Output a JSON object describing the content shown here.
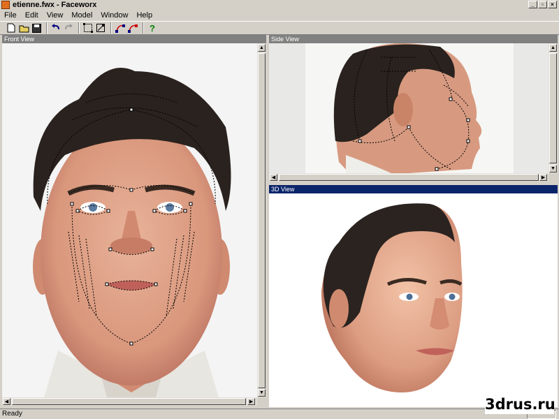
{
  "window": {
    "title": "etienne.fwx - Faceworx",
    "controls": [
      "_",
      "▫",
      "×"
    ]
  },
  "menu": [
    "File",
    "Edit",
    "View",
    "Model",
    "Window",
    "Help"
  ],
  "toolbar": {
    "buttons": [
      {
        "name": "new-icon",
        "glyph": "🗋"
      },
      {
        "name": "open-icon",
        "glyph": "📂"
      },
      {
        "name": "save-icon",
        "glyph": "💾"
      },
      {
        "name": "undo-icon",
        "glyph": "↶"
      },
      {
        "name": "redo-icon",
        "glyph": "↷"
      },
      {
        "name": "select-icon",
        "glyph": "⬚"
      },
      {
        "name": "move-points-icon",
        "glyph": "⤡"
      },
      {
        "name": "curve-add-icon",
        "glyph": "⌇"
      },
      {
        "name": "curve-edit-icon",
        "glyph": "⌇"
      },
      {
        "name": "help-icon",
        "glyph": "?"
      }
    ]
  },
  "panes": {
    "front": {
      "label": "Front View"
    },
    "side": {
      "label": "Side View"
    },
    "view3d": {
      "label": "3D View"
    }
  },
  "status": {
    "text": "Ready"
  },
  "watermark": "3drus.ru",
  "colors": {
    "window_bg": "#d4d0c8",
    "active_caption": "#0a246a",
    "inactive_caption": "#808080"
  }
}
